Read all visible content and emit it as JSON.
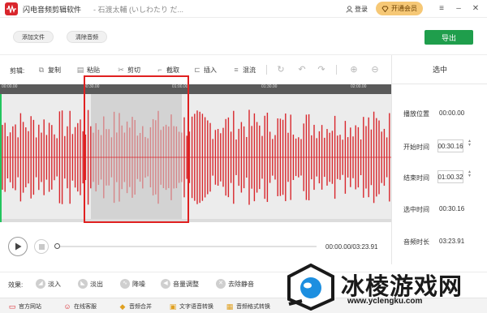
{
  "window": {
    "app_title": "闪电音频剪辑软件",
    "doc_title": "- 石渡太輔 (いしわたり だ...",
    "login_label": "登录",
    "vip_label": "开通会员"
  },
  "topbar": {
    "add_file_label": "添加文件",
    "clear_audio_label": "清除音频",
    "export_label": "导出"
  },
  "edit_toolbar": {
    "label": "剪辑:",
    "tools": [
      {
        "label": "复制",
        "icon": "copy-icon"
      },
      {
        "label": "粘贴",
        "icon": "paste-icon"
      },
      {
        "label": "剪切",
        "icon": "cut-icon"
      },
      {
        "label": "截取",
        "icon": "crop-icon"
      },
      {
        "label": "插入",
        "icon": "insert-icon"
      },
      {
        "label": "混流",
        "icon": "mix-icon"
      }
    ]
  },
  "timeline": {
    "ticks": [
      "00:00.00",
      "00:30.00",
      "01:00.00",
      "01:30.00",
      "02:00.00"
    ]
  },
  "player": {
    "time_readout": "00:00.00/03:23.91",
    "progress": 0
  },
  "selection_panel": {
    "title": "选中",
    "playback_position_label": "播放位置",
    "playback_position_value": "00:00.00",
    "start_time_label": "开始时间",
    "start_time_value": "00:30.16",
    "end_time_label": "结束时间",
    "end_time_value": "01:00.32",
    "selected_duration_label": "选中时间",
    "selected_duration_value": "00:30.16",
    "audio_duration_label": "音频时长",
    "audio_duration_value": "03:23.91"
  },
  "effects": {
    "label": "效果:",
    "items": [
      "淡入",
      "淡出",
      "降噪",
      "音量调整",
      "去除静音"
    ]
  },
  "bottombar": {
    "items": [
      "官方网站",
      "在线客服",
      "音频合并",
      "文字语音转换",
      "音频格式转换"
    ]
  },
  "watermark": {
    "text": "冰棱游戏网",
    "url": "www.yclengku.com"
  },
  "colors": {
    "waveform": "#d9262c",
    "selection_fill": "#d3d3d3",
    "export": "#1f9e4c",
    "vip": "#f6c876",
    "accent_green": "#22c55e"
  }
}
